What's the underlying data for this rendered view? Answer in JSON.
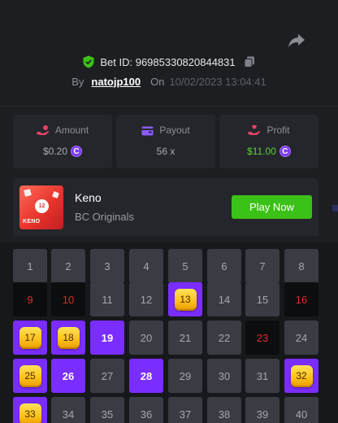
{
  "header": {
    "bet_id_label": "Bet ID: 96985330820844831",
    "by_label": "By",
    "username": "natojp100",
    "on_label": "On",
    "datetime": "10/02/2023 13:04:41"
  },
  "stats": [
    {
      "label": "Amount",
      "value": "$0.20",
      "coin": true,
      "color": "#a9abb0",
      "icon": "hand-coins-icon"
    },
    {
      "label": "Payout",
      "value": "56 x",
      "coin": false,
      "color": "#a9abb0",
      "icon": "wallet-icon"
    },
    {
      "label": "Profit",
      "value": "$11.00",
      "coin": true,
      "color": "#5bd234",
      "icon": "hand-heart-icon"
    }
  ],
  "coin_symbol": "C",
  "game": {
    "name": "Keno",
    "provider": "BC Originals",
    "play_label": "Play Now",
    "thumb_ball": "12",
    "thumb_text": "KENO"
  },
  "board": {
    "cells": [
      {
        "n": "1",
        "s": "plain"
      },
      {
        "n": "2",
        "s": "plain"
      },
      {
        "n": "3",
        "s": "plain"
      },
      {
        "n": "4",
        "s": "plain"
      },
      {
        "n": "5",
        "s": "plain"
      },
      {
        "n": "6",
        "s": "plain"
      },
      {
        "n": "7",
        "s": "plain"
      },
      {
        "n": "8",
        "s": "plain"
      },
      {
        "n": "9",
        "s": "black"
      },
      {
        "n": "10",
        "s": "black"
      },
      {
        "n": "11",
        "s": "plain"
      },
      {
        "n": "12",
        "s": "plain"
      },
      {
        "n": "13",
        "s": "hit"
      },
      {
        "n": "14",
        "s": "plain"
      },
      {
        "n": "15",
        "s": "plain"
      },
      {
        "n": "16",
        "s": "black"
      },
      {
        "n": "17",
        "s": "hit"
      },
      {
        "n": "18",
        "s": "hit"
      },
      {
        "n": "19",
        "s": "purple"
      },
      {
        "n": "20",
        "s": "plain"
      },
      {
        "n": "21",
        "s": "plain"
      },
      {
        "n": "22",
        "s": "plain"
      },
      {
        "n": "23",
        "s": "black"
      },
      {
        "n": "24",
        "s": "plain"
      },
      {
        "n": "25",
        "s": "hit"
      },
      {
        "n": "26",
        "s": "purple"
      },
      {
        "n": "27",
        "s": "plain"
      },
      {
        "n": "28",
        "s": "purple"
      },
      {
        "n": "29",
        "s": "plain"
      },
      {
        "n": "30",
        "s": "plain"
      },
      {
        "n": "31",
        "s": "plain"
      },
      {
        "n": "32",
        "s": "hit"
      },
      {
        "n": "33",
        "s": "hit"
      },
      {
        "n": "34",
        "s": "plain"
      },
      {
        "n": "35",
        "s": "plain"
      },
      {
        "n": "36",
        "s": "plain"
      },
      {
        "n": "37",
        "s": "plain"
      },
      {
        "n": "38",
        "s": "plain"
      },
      {
        "n": "39",
        "s": "plain"
      },
      {
        "n": "40",
        "s": "plain"
      }
    ]
  },
  "colors": {
    "accent_purple": "#7a2dff",
    "play_green": "#3bc117",
    "profit_green": "#5bd234",
    "miss_red": "#e02a2a",
    "hit_gold": "#ffc21c"
  }
}
